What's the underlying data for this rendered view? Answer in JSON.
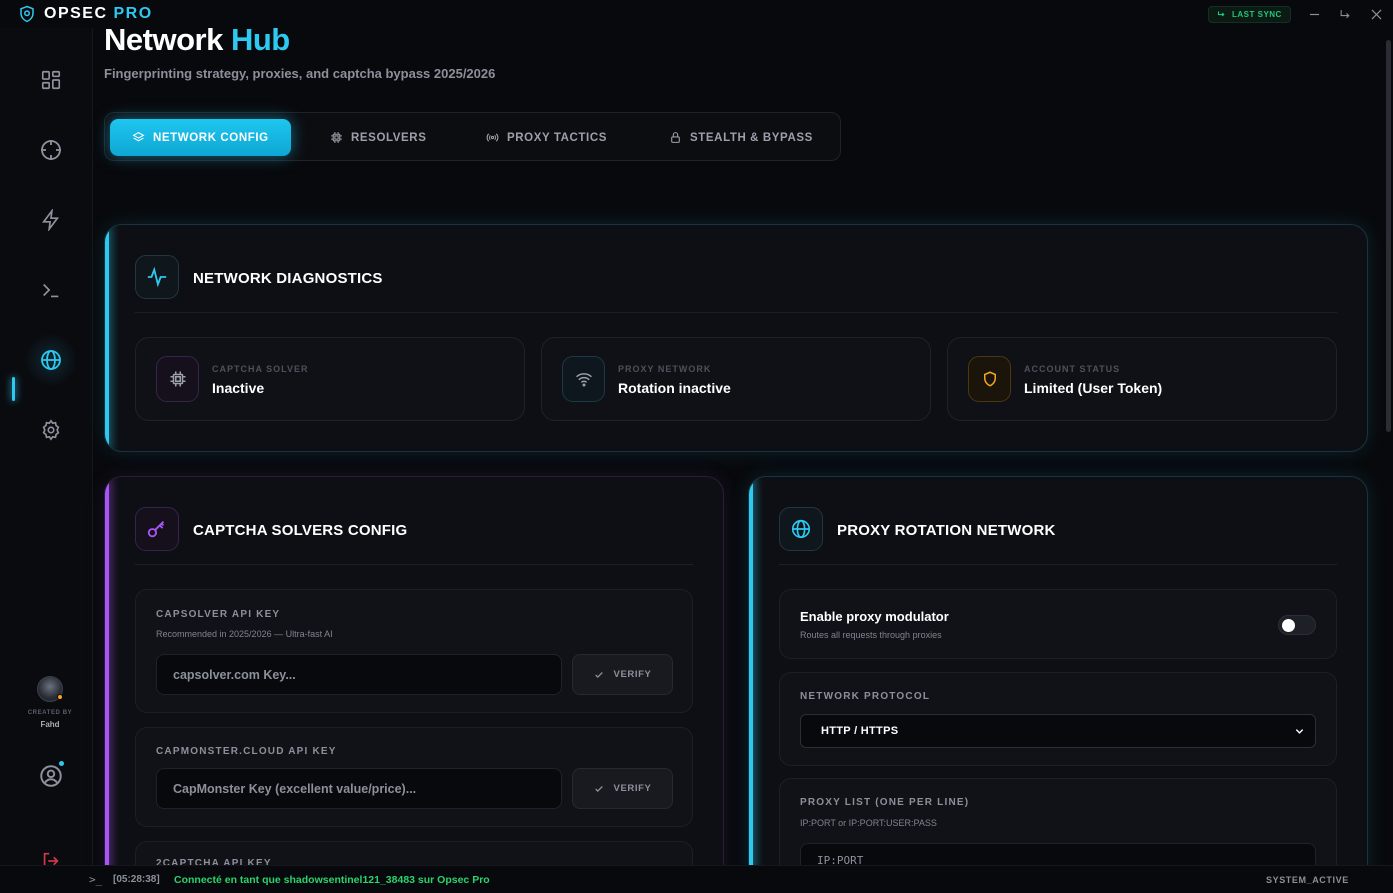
{
  "app": {
    "name_main": "OPSEC",
    "name_accent": "PRO"
  },
  "titlebar": {
    "sync_label": "LAST SYNC"
  },
  "header": {
    "title_main": "Network",
    "title_accent": "Hub",
    "subtitle": "Fingerprinting strategy, proxies, and captcha bypass 2025/2026"
  },
  "tabs": [
    {
      "label": "NETWORK CONFIG",
      "icon": "layers-icon",
      "active": true
    },
    {
      "label": "RESOLVERS",
      "icon": "chip-icon",
      "active": false
    },
    {
      "label": "PROXY TACTICS",
      "icon": "broadcast-icon",
      "active": false
    },
    {
      "label": "STEALTH & BYPASS",
      "icon": "lock-icon",
      "active": false
    }
  ],
  "sidebar": {
    "items": [
      "dashboard-icon",
      "crosshair-icon",
      "bolt-icon",
      "terminal-icon",
      "globe-icon",
      "gear-icon"
    ],
    "active_index": 4,
    "created_by_label": "CREATED BY",
    "creator": "Fahd"
  },
  "diagnostics": {
    "title": "NETWORK DIAGNOSTICS",
    "items": [
      {
        "label": "CAPTCHA SOLVER",
        "value": "Inactive",
        "icon": "chip-icon",
        "color": "#a855f7"
      },
      {
        "label": "PROXY NETWORK",
        "value": "Rotation inactive",
        "icon": "wifi-icon",
        "color": "#2dc9f0"
      },
      {
        "label": "ACCOUNT STATUS",
        "value": "Limited (User Token)",
        "icon": "shield-icon",
        "color": "#f5a524"
      }
    ]
  },
  "captcha": {
    "title": "CAPTCHA SOLVERS CONFIG",
    "capsolver": {
      "label": "CAPSOLVER API KEY",
      "hint": "Recommended in 2025/2026 — Ultra-fast AI",
      "placeholder": "capsolver.com Key...",
      "button": "VERIFY"
    },
    "capmonster": {
      "label": "CAPMONSTER.CLOUD API KEY",
      "placeholder": "CapMonster Key (excellent value/price)...",
      "button": "VERIFY"
    },
    "twocaptcha": {
      "label": "2CAPTCHA API KEY"
    }
  },
  "proxy": {
    "title": "PROXY ROTATION NETWORK",
    "toggle": {
      "label": "Enable proxy modulator",
      "hint": "Routes all requests through proxies",
      "enabled": false
    },
    "protocol": {
      "label": "NETWORK PROTOCOL",
      "value": "HTTP / HTTPS"
    },
    "list": {
      "label": "PROXY LIST (ONE PER LINE)",
      "hint": "IP:PORT or IP:PORT:USER:PASS",
      "placeholder": "IP:PORT"
    }
  },
  "footer": {
    "time": "[05:28:38]",
    "message": "Connecté en tant que shadowsentinel121_38483 sur Opsec Pro",
    "status": "SYSTEM_ACTIVE"
  },
  "colors": {
    "accent": "#2dc9f0",
    "purple": "#a855f7",
    "amber": "#f5a524",
    "success": "#2ad36d",
    "danger": "#d33a4a"
  }
}
